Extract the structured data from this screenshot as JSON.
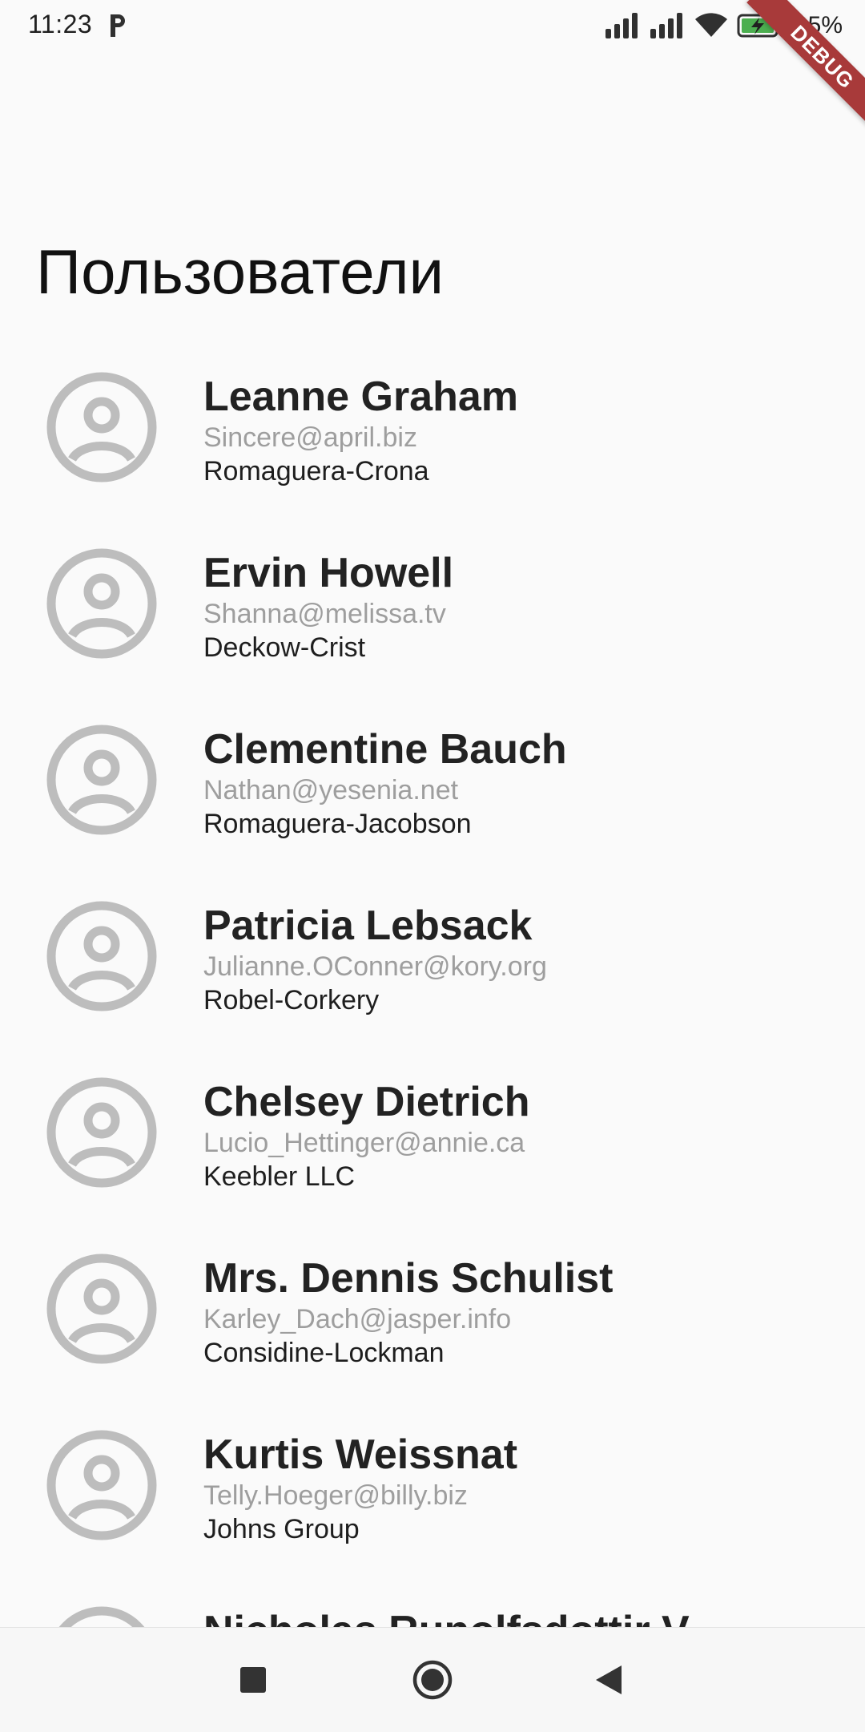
{
  "status_bar": {
    "time": "11:23",
    "battery": "95%",
    "icons": [
      "parking-notification-icon",
      "signal-icon",
      "signal-icon",
      "wifi-icon",
      "battery-charging-icon"
    ]
  },
  "debug_banner": "DEBUG",
  "title": "Пользователи",
  "users": [
    {
      "name": "Leanne Graham",
      "email": "Sincere@april.biz",
      "company": "Romaguera-Crona"
    },
    {
      "name": "Ervin Howell",
      "email": "Shanna@melissa.tv",
      "company": "Deckow-Crist"
    },
    {
      "name": "Clementine Bauch",
      "email": "Nathan@yesenia.net",
      "company": "Romaguera-Jacobson"
    },
    {
      "name": "Patricia Lebsack",
      "email": "Julianne.OConner@kory.org",
      "company": "Robel-Corkery"
    },
    {
      "name": "Chelsey Dietrich",
      "email": "Lucio_Hettinger@annie.ca",
      "company": "Keebler LLC"
    },
    {
      "name": "Mrs. Dennis Schulist",
      "email": "Karley_Dach@jasper.info",
      "company": "Considine-Lockman"
    },
    {
      "name": "Kurtis Weissnat",
      "email": "Telly.Hoeger@billy.biz",
      "company": "Johns Group"
    },
    {
      "name": "Nicholas Runolfsdottir V",
      "email": "",
      "company": ""
    }
  ],
  "colors": {
    "background": "#fafafa",
    "avatar": "#bdbdbd",
    "email": "#9e9e9e",
    "debug_banner": "#a83a3a",
    "battery_fill": "#4caf50"
  },
  "nav_bar": {
    "buttons": [
      "recent-apps-icon",
      "home-icon",
      "back-icon"
    ]
  }
}
